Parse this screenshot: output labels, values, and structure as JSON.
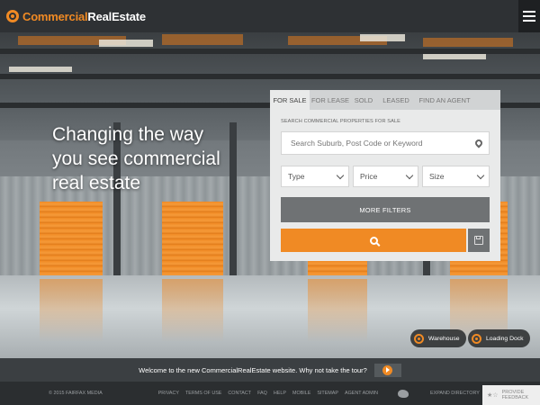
{
  "header": {
    "brand_commercial": "Commercial",
    "brand_realestate": "RealEstate"
  },
  "hero": {
    "headline_lines": [
      "Changing the way",
      "you see commercial",
      "real estate"
    ]
  },
  "search_panel": {
    "tabs": [
      {
        "label": "FOR SALE",
        "active": true
      },
      {
        "label": "FOR LEASE",
        "active": false
      },
      {
        "label": "SOLD",
        "active": false
      },
      {
        "label": "LEASED",
        "active": false
      },
      {
        "label": "FIND AN AGENT",
        "active": false
      }
    ],
    "section_label": "SEARCH COMMERCIAL PROPERTIES FOR SALE",
    "search_placeholder": "Search Suburb, Post Code or Keyword",
    "dropdowns": {
      "type": "Type",
      "price": "Price",
      "size": "Size"
    },
    "more_filters": "MORE FILTERS"
  },
  "tags": {
    "warehouse": "Warehouse",
    "loading_dock": "Loading Dock"
  },
  "tour": {
    "message": "Welcome to the new CommercialRealEstate website. Why not take the tour?"
  },
  "footer": {
    "copyright": "© 2015 FAIRFAX MEDIA",
    "links": [
      "PRIVACY",
      "TERMS OF USE",
      "CONTACT",
      "FAQ",
      "HELP",
      "MOBILE",
      "SITEMAP",
      "AGENT ADMIN"
    ],
    "expand": "EXPAND DIRECTORY",
    "feedback_line1": "PROVIDE",
    "feedback_line2": "FEEDBACK"
  },
  "colors": {
    "accent": "#f08a24",
    "header_bg": "#2e3134",
    "panel_bg": "#e9eaea"
  }
}
